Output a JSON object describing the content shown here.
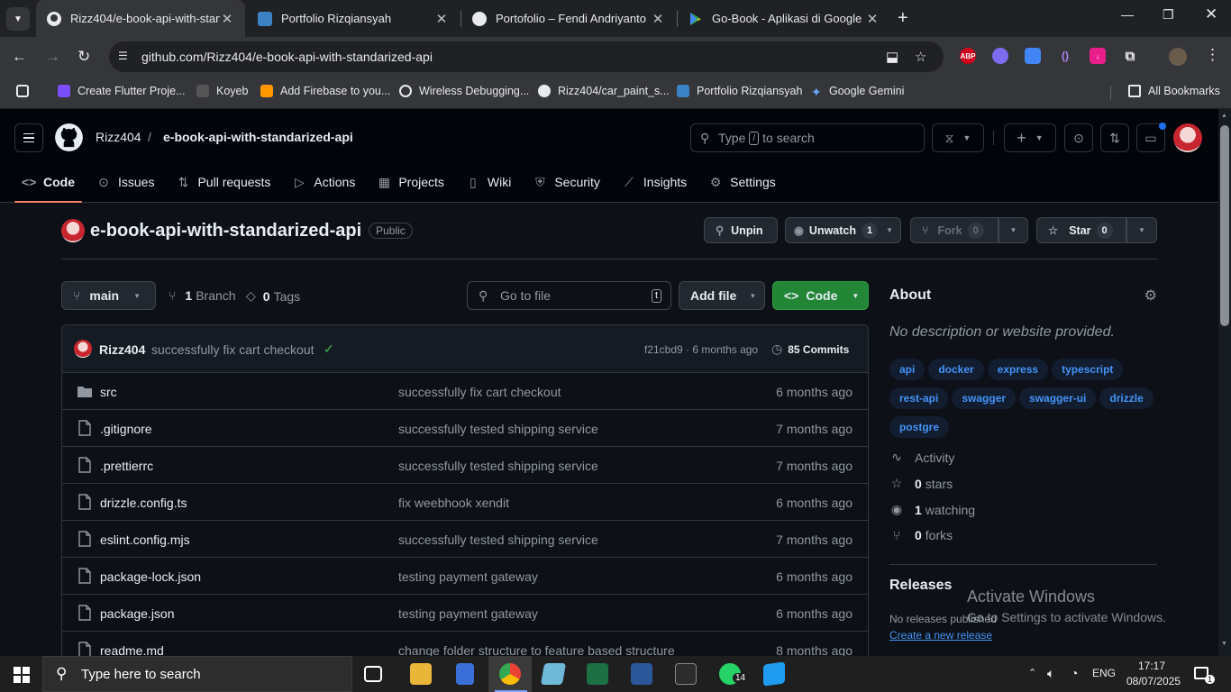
{
  "browser": {
    "tabs": [
      {
        "title": "Rizz404/e-book-api-with-standarized-api",
        "active": true
      },
      {
        "title": "Portfolio Rizqiansyah"
      },
      {
        "title": "Portofolio – Fendi Andriyanto"
      },
      {
        "title": "Go-Book - Aplikasi di Google Play"
      }
    ],
    "url": "github.com/Rizz404/e-book-api-with-standarized-api",
    "bookmarks": [
      "Create Flutter Proje...",
      "Koyeb",
      "Add Firebase to you...",
      "Wireless Debugging...",
      "Rizz404/car_paint_s...",
      "Portfolio Rizqiansyah",
      "Google Gemini"
    ],
    "all_bookmarks": "All Bookmarks",
    "abp_label": "ABP"
  },
  "header": {
    "owner": "Rizz404",
    "separator": "/",
    "repo": "e-book-api-with-standarized-api",
    "search_type": "Type",
    "search_key": "/",
    "search_rest": "to search"
  },
  "repo_nav": [
    {
      "label": "Code",
      "icon": "code-icon"
    },
    {
      "label": "Issues",
      "icon": "issue-icon"
    },
    {
      "label": "Pull requests",
      "icon": "pr-icon"
    },
    {
      "label": "Actions",
      "icon": "play-icon"
    },
    {
      "label": "Projects",
      "icon": "table-icon"
    },
    {
      "label": "Wiki",
      "icon": "book-icon"
    },
    {
      "label": "Security",
      "icon": "shield-icon"
    },
    {
      "label": "Insights",
      "icon": "graph-icon"
    },
    {
      "label": "Settings",
      "icon": "gear-icon"
    }
  ],
  "repo": {
    "name": "e-book-api-with-standarized-api",
    "visibility": "Public",
    "unpin": "Unpin",
    "unwatch": "Unwatch",
    "watch_count": "1",
    "fork": "Fork",
    "fork_count": "0",
    "star": "Star",
    "star_count": "0"
  },
  "toolbar": {
    "branch": "main",
    "branches_n": "1",
    "branches_label": "Branch",
    "tags_n": "0",
    "tags_label": "Tags",
    "goto_placeholder": "Go to file",
    "goto_key": "t",
    "add_file": "Add file",
    "code": "Code"
  },
  "commit": {
    "author": "Rizz404",
    "message": "successfully fix cart checkout",
    "hash": "f21cbd9",
    "sep": "·",
    "age": "6 months ago",
    "commits_n": "85",
    "commits_label": "Commits"
  },
  "files": [
    {
      "name": "src",
      "type": "dir",
      "msg": "successfully fix cart checkout",
      "date": "6 months ago"
    },
    {
      "name": ".gitignore",
      "type": "file",
      "msg": "successfully tested shipping service",
      "date": "7 months ago"
    },
    {
      "name": ".prettierrc",
      "type": "file",
      "msg": "successfully tested shipping service",
      "date": "7 months ago"
    },
    {
      "name": "drizzle.config.ts",
      "type": "file",
      "msg": "fix weebhook xendit",
      "date": "6 months ago"
    },
    {
      "name": "eslint.config.mjs",
      "type": "file",
      "msg": "successfully tested shipping service",
      "date": "7 months ago"
    },
    {
      "name": "package-lock.json",
      "type": "file",
      "msg": "testing payment gateway",
      "date": "6 months ago"
    },
    {
      "name": "package.json",
      "type": "file",
      "msg": "testing payment gateway",
      "date": "6 months ago"
    },
    {
      "name": "readme.md",
      "type": "file",
      "msg": "change folder structure to feature based structure",
      "date": "8 months ago"
    }
  ],
  "about": {
    "title": "About",
    "description": "No description or website provided.",
    "topics": [
      "api",
      "docker",
      "express",
      "typescript",
      "rest-api",
      "swagger",
      "swagger-ui",
      "drizzle",
      "postgre"
    ],
    "activity": "Activity",
    "stars_n": "0",
    "stars_label": "stars",
    "watching_n": "1",
    "watching_label": "watching",
    "forks_n": "0",
    "forks_label": "forks",
    "releases_title": "Releases",
    "no_releases": "No releases published",
    "create_release": "Create a new release"
  },
  "watermark": {
    "line1": "Activate Windows",
    "line2": "Go to Settings to activate Windows."
  },
  "taskbar": {
    "search_placeholder": "Type here to search",
    "lang": "ENG",
    "time": "17:17",
    "date": "08/07/2025",
    "whatsapp_badge": "14",
    "notif_badge": "1"
  }
}
